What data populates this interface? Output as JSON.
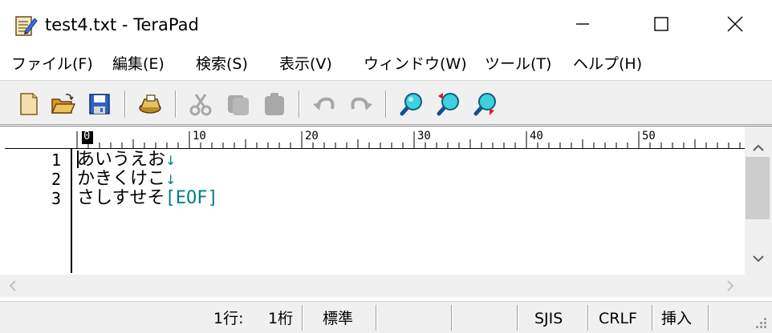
{
  "window": {
    "title": "test4.txt - TeraPad",
    "app_icon": "terapad-notepad-icon",
    "controls": {
      "minimize": "minimize-icon",
      "maximize": "maximize-icon",
      "close": "close-icon"
    }
  },
  "menu": {
    "items": [
      {
        "label": "ファイル(F)"
      },
      {
        "label": "編集(E)"
      },
      {
        "label": "検索(S)"
      },
      {
        "label": "表示(V)"
      },
      {
        "label": "ウィンドウ(W)"
      },
      {
        "label": "ツール(T)"
      },
      {
        "label": "ヘルプ(H)"
      }
    ]
  },
  "toolbar": {
    "icons": [
      "new-file-icon",
      "open-folder-icon",
      "save-icon",
      "print-icon",
      "cut-icon",
      "copy-icon",
      "paste-icon",
      "undo-icon",
      "redo-icon",
      "search-icon",
      "search-prev-icon",
      "search-next-icon"
    ]
  },
  "ruler": {
    "labels": [
      "0",
      "10",
      "20",
      "30",
      "40",
      "50"
    ]
  },
  "editor": {
    "lines": [
      {
        "number": "1",
        "text": "あいうえお",
        "end": "↓"
      },
      {
        "number": "2",
        "text": "かきくけこ",
        "end": "↓"
      },
      {
        "number": "3",
        "text": "さしすせそ",
        "end": "[EOF]"
      }
    ],
    "colors": {
      "marker": "#008080",
      "text": "#000000"
    }
  },
  "status": {
    "line": "1行:",
    "column": "1桁",
    "mode": "標準",
    "encoding": "SJIS",
    "newline": "CRLF",
    "insert_mode": "挿入"
  }
}
